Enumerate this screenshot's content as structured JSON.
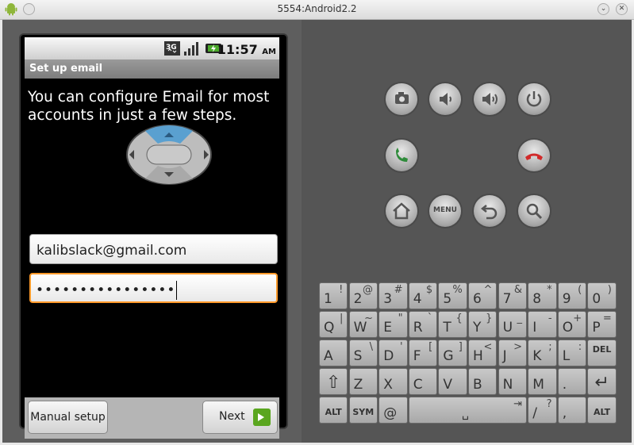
{
  "window": {
    "title": "5554:Android2.2"
  },
  "statusbar": {
    "network": "3G",
    "time": "11:57",
    "ampm": "AM"
  },
  "screen": {
    "title": "Set up email",
    "intro": "You can configure Email for most accounts in just a few steps.",
    "email_value": "kalibslack@gmail.com",
    "password_value": "••••••••••••••••",
    "manual_setup_label": "Manual setup",
    "next_label": "Next"
  },
  "controls": {
    "camera": "camera-icon",
    "volume_down": "volume-down-icon",
    "volume_up": "volume-up-icon",
    "power": "power-icon",
    "call": "call-icon",
    "end_call": "end-call-icon",
    "home": "home-icon",
    "menu_label": "MENU",
    "back": "back-icon",
    "search": "search-icon"
  },
  "keyboard": {
    "rows": [
      [
        {
          "k": "1",
          "a": "!"
        },
        {
          "k": "2",
          "a": "@"
        },
        {
          "k": "3",
          "a": "#"
        },
        {
          "k": "4",
          "a": "$"
        },
        {
          "k": "5",
          "a": "%"
        },
        {
          "k": "6",
          "a": "^"
        },
        {
          "k": "7",
          "a": "&"
        },
        {
          "k": "8",
          "a": "*"
        },
        {
          "k": "9",
          "a": "("
        },
        {
          "k": "0",
          "a": ")"
        }
      ],
      [
        {
          "k": "Q",
          "a": "|"
        },
        {
          "k": "W",
          "a": "~"
        },
        {
          "k": "E",
          "a": "\""
        },
        {
          "k": "R",
          "a": "`"
        },
        {
          "k": "T",
          "a": "{"
        },
        {
          "k": "Y",
          "a": "}"
        },
        {
          "k": "U",
          "a": "_"
        },
        {
          "k": "I",
          "a": "-"
        },
        {
          "k": "O",
          "a": "+"
        },
        {
          "k": "P",
          "a": "="
        }
      ],
      [
        {
          "k": "A",
          "a": ""
        },
        {
          "k": "S",
          "a": "\\"
        },
        {
          "k": "D",
          "a": "'"
        },
        {
          "k": "F",
          "a": "["
        },
        {
          "k": "G",
          "a": "]"
        },
        {
          "k": "H",
          "a": "<"
        },
        {
          "k": "J",
          "a": ">"
        },
        {
          "k": "K",
          "a": ";"
        },
        {
          "k": "L",
          "a": ":"
        },
        {
          "k": "DEL",
          "a": ""
        }
      ],
      [
        {
          "k": "⇧",
          "a": ""
        },
        {
          "k": "Z",
          "a": ""
        },
        {
          "k": "X",
          "a": ""
        },
        {
          "k": "C",
          "a": ""
        },
        {
          "k": "V",
          "a": ""
        },
        {
          "k": "B",
          "a": ""
        },
        {
          "k": "N",
          "a": ""
        },
        {
          "k": "M",
          "a": ""
        },
        {
          "k": ".",
          "a": ""
        },
        {
          "k": "↵",
          "a": ""
        }
      ],
      [
        {
          "k": "ALT",
          "a": ""
        },
        {
          "k": "SYM",
          "a": ""
        },
        {
          "k": "@",
          "a": ""
        },
        {
          "k": "␣",
          "a": "⇥"
        },
        {
          "k": "/",
          "a": "?"
        },
        {
          "k": ",",
          "a": ""
        },
        {
          "k": "ALT",
          "a": ""
        }
      ]
    ]
  },
  "colors": {
    "focus": "#ff9a2a",
    "dpad_up": "#5aa0d0",
    "call": "#2e8b3a",
    "end_call": "#d12a2a",
    "next_arrow": "#5aa61f"
  }
}
